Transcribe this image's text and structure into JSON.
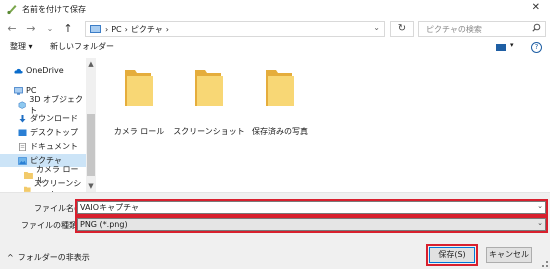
{
  "window": {
    "title": "名前を付けて保存",
    "close_glyph": "✕"
  },
  "nav": {
    "back_glyph": "←",
    "forward_glyph": "→",
    "recent_glyph": "⌄",
    "up_glyph": "↑",
    "breadcrumb": [
      "PC",
      "ピクチャ"
    ],
    "breadcrumb_sep": "›",
    "address_dropdown_glyph": "⌄",
    "refresh_glyph": "↻",
    "search_placeholder": "ピクチャの検索"
  },
  "toolbar": {
    "organize_label": "整理 ▾",
    "new_folder_label": "新しいフォルダー",
    "help_glyph": "?",
    "view_caret": "▾"
  },
  "sidebar": {
    "items": [
      {
        "label": "OneDrive",
        "icon": "cloud-icon"
      },
      {
        "label": "PC",
        "icon": "pc-icon"
      },
      {
        "label": "3D オブジェクト",
        "icon": "cube-icon"
      },
      {
        "label": "ダウンロード",
        "icon": "download-icon"
      },
      {
        "label": "デスクトップ",
        "icon": "desktop-icon"
      },
      {
        "label": "ドキュメント",
        "icon": "document-icon"
      },
      {
        "label": "ピクチャ",
        "icon": "pictures-icon"
      },
      {
        "label": "カメラ ロール",
        "icon": "folder-icon"
      },
      {
        "label": "スクリーンショット",
        "icon": "folder-icon"
      }
    ],
    "expand_glyph": "›"
  },
  "files": [
    {
      "name": "カメラ ロール"
    },
    {
      "name": "スクリーンショット"
    },
    {
      "name": "保存済みの写真"
    }
  ],
  "form": {
    "filename_label": "ファイル名(N):",
    "filename_value": "VAIOキャプチャ",
    "filetype_label": "ファイルの種類(T):",
    "filetype_value": "PNG (*.png)",
    "dropdown_glyph": "⌄"
  },
  "buttons": {
    "save": "保存(S)",
    "cancel": "キャンセル"
  },
  "footer": {
    "hide_folders_label": "フォルダーの非表示",
    "caret_glyph": "^"
  },
  "colors": {
    "accent": "#0078d7",
    "highlight_box": "#d8202e",
    "folder": "#f2ca6a",
    "selected_bg": "#cce4f7"
  }
}
